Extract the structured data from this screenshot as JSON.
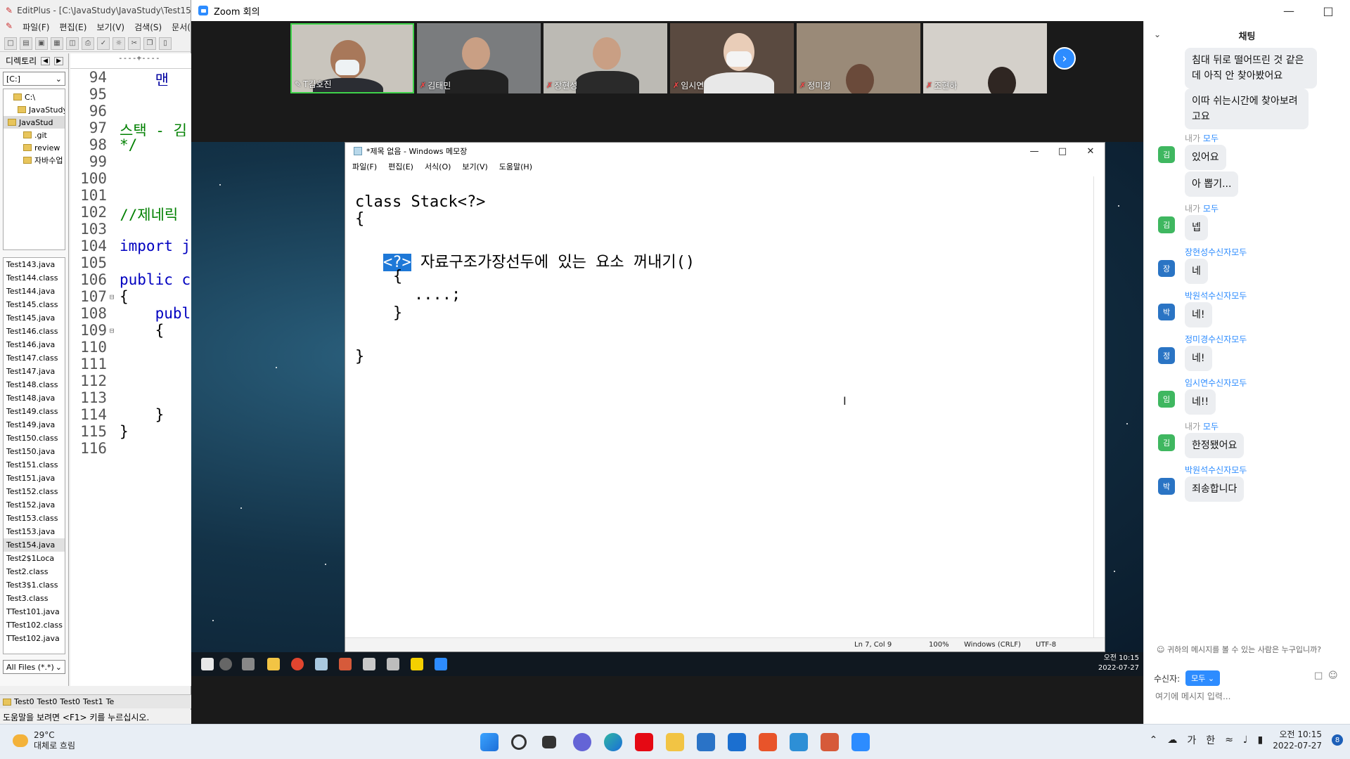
{
  "editplus": {
    "title": "EditPlus - [C:\\JavaStudy\\JavaStudy\\Test154",
    "menu": [
      "파일(F)",
      "편집(E)",
      "보기(V)",
      "검색(S)",
      "문서("
    ],
    "dir_label": "디렉토리",
    "drive": "[C:]",
    "tree": [
      "C:\\",
      "JavaStudy",
      "JavaStud",
      ".git",
      "review",
      "자바수업"
    ],
    "files": [
      "Test143.java",
      "Test144.class",
      "Test144.java",
      "Test145.class",
      "Test145.java",
      "Test146.class",
      "Test146.java",
      "Test147.class",
      "Test147.java",
      "Test148.class",
      "Test148.java",
      "Test149.class",
      "Test149.java",
      "Test150.class",
      "Test150.java",
      "Test151.class",
      "Test151.java",
      "Test152.class",
      "Test152.java",
      "Test153.class",
      "Test153.java",
      "Test154.java",
      "Test2$1Loca",
      "Test2.class",
      "Test3$1.class",
      "Test3.class",
      "TTest101.java",
      "TTest102.class",
      "TTest102.java"
    ],
    "filter": "All Files (*.*)",
    "ruler": "----+----",
    "lines": [
      {
        "num": "94",
        "text": "    맨"
      },
      {
        "num": "95",
        "text": ""
      },
      {
        "num": "96",
        "text": ""
      },
      {
        "num": "97",
        "text": "스택 - 김"
      },
      {
        "num": "98",
        "text": "*/"
      },
      {
        "num": "99",
        "text": ""
      },
      {
        "num": "100",
        "text": ""
      },
      {
        "num": "101",
        "text": ""
      },
      {
        "num": "102",
        "text": "//제네릭"
      },
      {
        "num": "103",
        "text": ""
      },
      {
        "num": "104",
        "text": "import j"
      },
      {
        "num": "105",
        "text": ""
      },
      {
        "num": "106",
        "text": "public c"
      },
      {
        "num": "107",
        "text": "{"
      },
      {
        "num": "108",
        "text": "    publ"
      },
      {
        "num": "109",
        "text": "    {"
      },
      {
        "num": "110",
        "text": ""
      },
      {
        "num": "111",
        "text": ""
      },
      {
        "num": "112",
        "text": ""
      },
      {
        "num": "113",
        "text": ""
      },
      {
        "num": "114",
        "text": "    }"
      },
      {
        "num": "115",
        "text": "}"
      },
      {
        "num": "116",
        "text": ""
      }
    ],
    "tabs": [
      "Test0",
      "Test0",
      "Test0",
      "Test1",
      "Te"
    ],
    "status": "도움말을 보려면 <F1> 키를 누르십시오."
  },
  "zoom": {
    "title": "Zoom 회의",
    "participants": [
      "T김호진",
      "김태민",
      "장현성",
      "임시연",
      "정미경",
      "조현하"
    ],
    "colors": {
      "accent": "#2d8cff",
      "active_border": "#3fd24a",
      "mic_off": "#ff4b4b"
    }
  },
  "notepad": {
    "title": "*제목 없음 - Windows 메모장",
    "menu": [
      "파일(F)",
      "편집(E)",
      "서식(O)",
      "보기(V)",
      "도움말(H)"
    ],
    "line1": "class Stack<?>",
    "line2": "{",
    "sel": "<?>",
    "line3": " 자료구조가장선두에 있는 요소 꺼내기()",
    "line4": "{",
    "line5": "....;",
    "line6": "}",
    "line7": "}",
    "status": {
      "pos": "Ln 7, Col 9",
      "zoom": "100%",
      "eol": "Windows (CRLF)",
      "enc": "UTF-8"
    },
    "clock_time": "오전 10:15",
    "clock_date": "2022-07-27"
  },
  "chat": {
    "title": "채팅",
    "messages": [
      {
        "text1": "침대 뒤로 떨어뜨린 것 같은",
        "text2": "데 아직 안 찾아봤어요"
      },
      {
        "text1": "이따 쉬는시간에 찾아보려",
        "text2": "고요"
      },
      {
        "sender": "내가",
        "to": "모두",
        "avatar": "김",
        "text": "있어요"
      },
      {
        "text": "아 뽑기..."
      },
      {
        "sender": "내가",
        "to": "모두",
        "avatar": "김",
        "text": "넵"
      },
      {
        "sender": "장현성수신자모두",
        "avatar": "장",
        "text": "네"
      },
      {
        "sender": "박원석수신자모두",
        "avatar": "박",
        "text": "네!"
      },
      {
        "sender": "정미경수신자모두",
        "avatar": "정",
        "text": "네!"
      },
      {
        "sender": "임시연수신자모두",
        "avatar": "임",
        "text": "네!!"
      },
      {
        "sender": "내가",
        "to": "모두",
        "avatar": "김",
        "text": "한정됐어요"
      },
      {
        "sender": "박원석수신자모두",
        "avatar": "박",
        "text": "죄송합니다"
      }
    ],
    "notice": "귀하의 메시지를 볼 수 있는 사람은 누구입니까?",
    "to_label": "수신자:",
    "to_value": "모두",
    "input_placeholder": "여기에 메시지 입력..."
  },
  "taskbar": {
    "temp": "29°C",
    "weather": "대체로 흐림",
    "ime1": "가",
    "ime2": "한",
    "time": "오전 10:15",
    "date": "2022-07-27",
    "notifications": "8"
  }
}
